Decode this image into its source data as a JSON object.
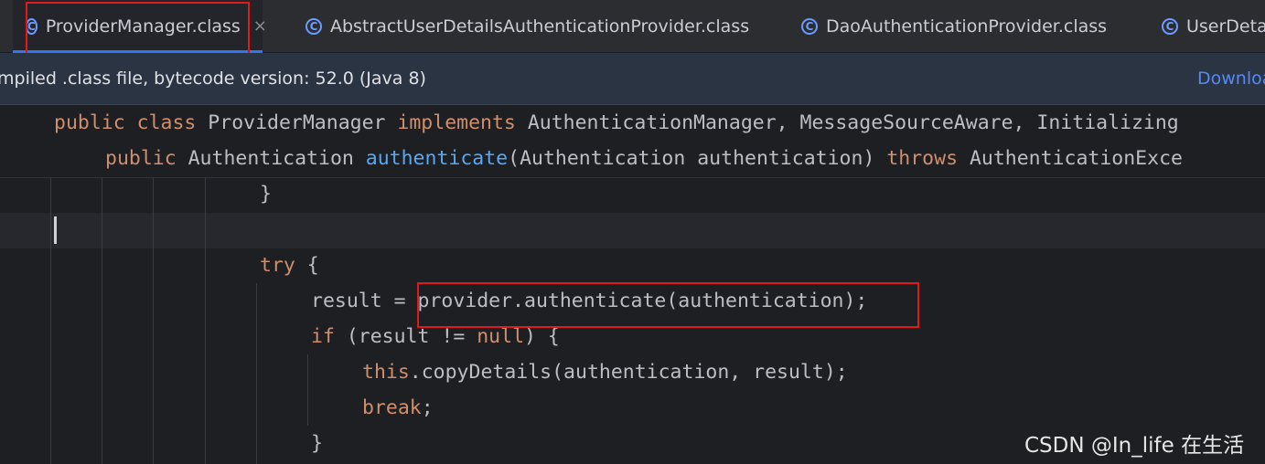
{
  "tabs": [
    {
      "label": "ProviderManager.class",
      "active": true,
      "close": "×"
    },
    {
      "label": "AbstractUserDetailsAuthenticationProvider.class"
    },
    {
      "label": "DaoAuthenticationProvider.class"
    },
    {
      "label": "UserDeta"
    }
  ],
  "tab_icon_glyph": "C",
  "infobar": {
    "message": "mpiled .class file, bytecode version: 52.0 (Java 8)",
    "link": "Downloa"
  },
  "sticky": {
    "line1": {
      "kw1": "public",
      "kw2": "class",
      "name": " ProviderManager ",
      "kw3": "implements",
      "rest": " AuthenticationManager, MessageSourceAware, Initializing"
    },
    "line2": {
      "kw1": "public",
      "type": " Authentication ",
      "fn": "authenticate",
      "args": "(Authentication authentication) ",
      "kw2": "throws",
      "rest": " AuthenticationExce"
    }
  },
  "code": {
    "l1": "}",
    "l3_kw": "try",
    "l3_rest": " {",
    "l4_pre": "result = ",
    "l4_call": "provider.authenticate(authentication);",
    "l5_kw": "if",
    "l5_mid": " (result != ",
    "l5_null": "null",
    "l5_end": ") {",
    "l6_kw": "this",
    "l6_rest": ".copyDetails(authentication, result);",
    "l7_kw": "break",
    "l7_rest": ";",
    "l8": "}"
  },
  "watermark": "CSDN @In_life 在生活",
  "colors": {
    "keyword": "#cf8e6d",
    "function": "#56a8f5",
    "text": "#bcbec4",
    "highlight_box": "#e0191b",
    "link": "#548af7"
  }
}
